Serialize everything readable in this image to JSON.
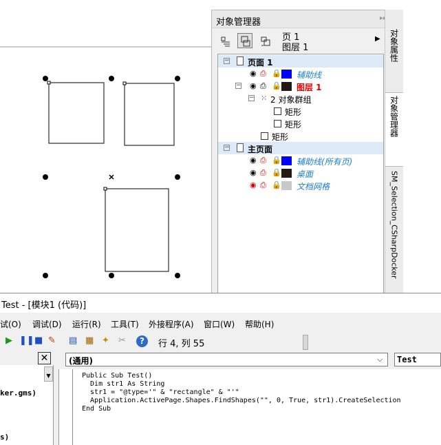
{
  "docker": {
    "title": "对象管理器",
    "page_name": "页 1",
    "layer_name": "图层 1"
  },
  "tree": {
    "page1_label": "页面 1",
    "guides_label": "辅助线",
    "layer1_label": "图层 1",
    "group_label": "2 对象群组",
    "rect1_label": "矩形",
    "rect2_label": "矩形",
    "rect3_label": "矩形",
    "master_label": "主页面",
    "master_guides_label": "辅助线(所有页)",
    "desktop_label": "桌面",
    "grid_label": "文档网格",
    "colors": {
      "guides": "#0000ff",
      "layer1": "#221a15",
      "desktop": "#221a15",
      "grid": "#c8c8c8",
      "layer_name": "#e00000"
    }
  },
  "tabs": [
    "对象属性",
    "对象管理器",
    "SM_Selection_CSharpDocker"
  ],
  "vba": {
    "title": "Test - [模块1 (代码)]",
    "menu": [
      "试(O)",
      "调试(D)",
      "运行(R)",
      "工具(T)",
      "外接程序(A)",
      "窗口(W)",
      "帮助(H)"
    ],
    "row_col": "行 4, 列 55",
    "project_lines": [
      "ker.gms)",
      "s)"
    ],
    "object_combo": "(通用)",
    "proc_combo": "Test",
    "code": [
      "Public Sub Test()",
      "  Dim str1 As String",
      "  str1 = \"@type='\" & \"rectangle\" & \"'\"",
      "  Application.ActivePage.Shapes.FindShapes(\"\", 0, True, str1).CreateSelection",
      "End Sub"
    ]
  }
}
